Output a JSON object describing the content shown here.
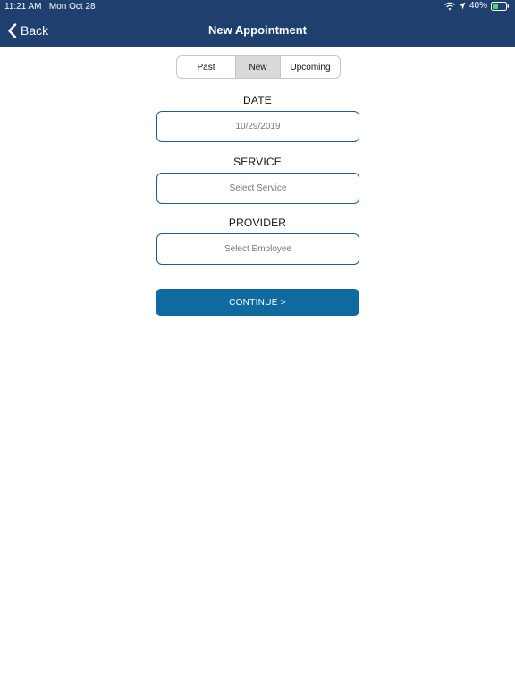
{
  "status_bar": {
    "time": "11:21 AM",
    "date": "Mon Oct 28",
    "battery": "40%"
  },
  "header": {
    "back_label": "Back",
    "title": "New Appointment",
    "background_color": "#1f3f6e"
  },
  "segments": {
    "past": "Past",
    "new": "New",
    "upcoming": "Upcoming",
    "selected": "New"
  },
  "form": {
    "date_label": "DATE",
    "date_value": "10/29/2019",
    "service_label": "SERVICE",
    "service_placeholder": "Select Service",
    "provider_label": "PROVIDER",
    "provider_placeholder": "Select Employee"
  },
  "continue_label": "CONTINUE >",
  "accent_color": "#0f6aa0"
}
